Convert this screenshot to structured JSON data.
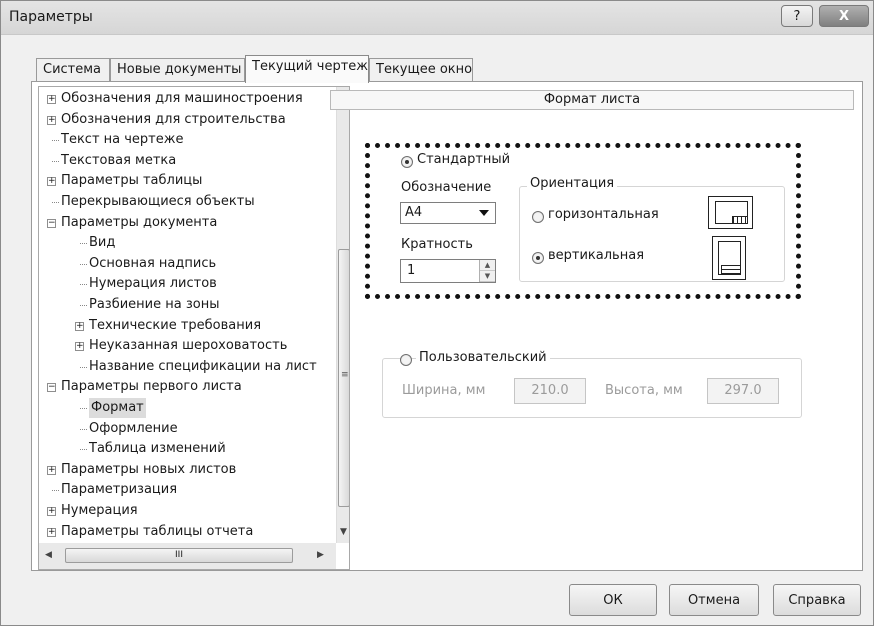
{
  "window": {
    "title": "Параметры",
    "help_glyph": "?",
    "close_glyph": "X"
  },
  "tabs": [
    {
      "label": "Система",
      "active": false
    },
    {
      "label": "Новые документы",
      "active": false
    },
    {
      "label": "Текущий чертеж",
      "active": true
    },
    {
      "label": "Текущее окно",
      "active": false
    }
  ],
  "tree": {
    "items": [
      {
        "label": "Обозначения для машиностроения",
        "expander": "+"
      },
      {
        "label": "Обозначения для строительства",
        "expander": "+"
      },
      {
        "label": "Текст на чертеже",
        "expander": ""
      },
      {
        "label": "Текстовая метка",
        "expander": ""
      },
      {
        "label": "Параметры таблицы",
        "expander": "+"
      },
      {
        "label": "Перекрывающиеся объекты",
        "expander": ""
      },
      {
        "label": "Параметры документа",
        "expander": "−"
      },
      {
        "label": "Вид",
        "expander": ""
      },
      {
        "label": "Основная надпись",
        "expander": ""
      },
      {
        "label": "Нумерация листов",
        "expander": ""
      },
      {
        "label": "Разбиение на зоны",
        "expander": ""
      },
      {
        "label": "Технические требования",
        "expander": "+"
      },
      {
        "label": "Неуказанная шероховатость",
        "expander": "+"
      },
      {
        "label": "Название спецификации на лист",
        "expander": ""
      },
      {
        "label": "Параметры первого листа",
        "expander": "−"
      },
      {
        "label": "Формат",
        "expander": "",
        "selected": true
      },
      {
        "label": "Оформление",
        "expander": ""
      },
      {
        "label": "Таблица изменений",
        "expander": ""
      },
      {
        "label": "Параметры новых листов",
        "expander": "+"
      },
      {
        "label": "Параметризация",
        "expander": ""
      },
      {
        "label": "Нумерация",
        "expander": "+"
      },
      {
        "label": "Параметры таблицы отчета",
        "expander": "+"
      }
    ],
    "hscroll_glyph": "III"
  },
  "panel": {
    "header": "Формат листа",
    "standard": {
      "label": "Стандартный",
      "selected": true,
      "designation_label": "Обозначение",
      "designation_value": "A4",
      "multiplicity_label": "Кратность",
      "multiplicity_value": "1"
    },
    "orientation": {
      "title": "Ориентация",
      "horizontal_label": "горизонтальная",
      "vertical_label": "вертикальная",
      "selected": "vertical"
    },
    "custom": {
      "label": "Пользовательский",
      "selected": false,
      "width_label": "Ширина, мм",
      "width_value": "210.0",
      "height_label": "Высота, мм",
      "height_value": "297.0"
    }
  },
  "buttons": {
    "ok": "ОК",
    "cancel": "Отмена",
    "help": "Справка"
  }
}
